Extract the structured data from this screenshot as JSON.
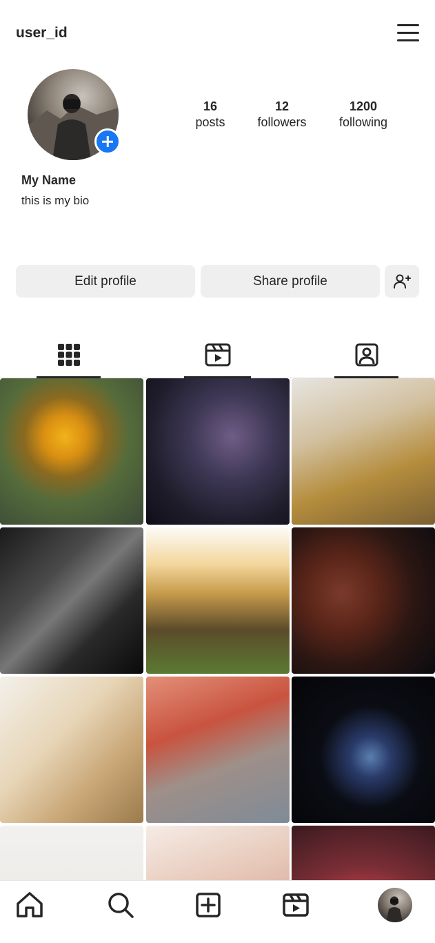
{
  "header": {
    "username": "user_id"
  },
  "profile": {
    "display_name": "My Name",
    "bio": "this is my bio",
    "stats": {
      "posts": {
        "value": "16",
        "label": "posts"
      },
      "followers": {
        "value": "12",
        "label": "followers"
      },
      "following": {
        "value": "1200",
        "label": "following"
      }
    }
  },
  "actions": {
    "edit_label": "Edit profile",
    "share_label": "Share profile"
  },
  "tabs": [
    {
      "icon": "grid-icon",
      "active": true
    },
    {
      "icon": "reels-icon",
      "active": true
    },
    {
      "icon": "tagged-icon",
      "active": true
    }
  ],
  "grid": [
    "flower",
    "milky-way",
    "girl-with-phone",
    "night-street",
    "sunset-hair",
    "hooded-woman",
    "desk-supplies",
    "woman-in-truck",
    "laptop-glow",
    "sky",
    "hands",
    "dahlia"
  ],
  "bottom_nav": [
    "home-icon",
    "search-icon",
    "add-post-icon",
    "reels-icon",
    "profile-avatar"
  ],
  "colors": {
    "accent": "#1877f2",
    "button_bg": "#efefef",
    "text": "#262626"
  }
}
